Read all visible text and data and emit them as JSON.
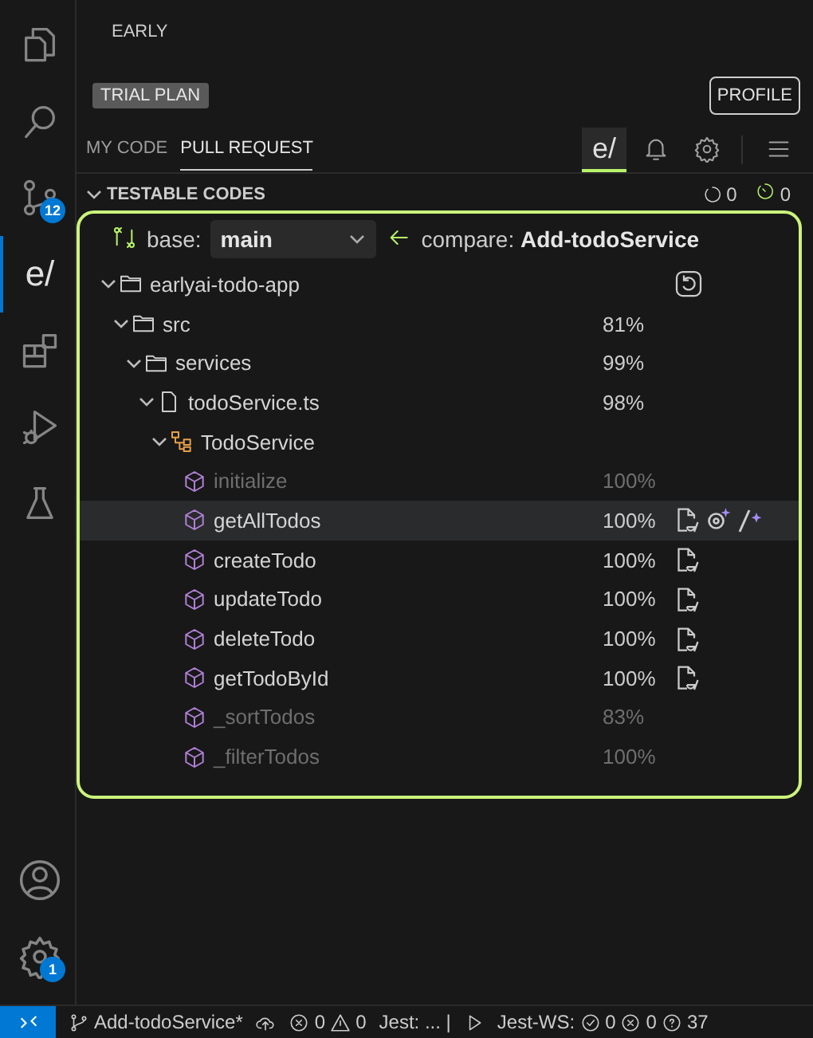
{
  "activity_bar": {
    "items": [
      {
        "kind": "files",
        "selected": false
      },
      {
        "kind": "search",
        "selected": false
      },
      {
        "kind": "source-control",
        "selected": false,
        "badge": "12"
      },
      {
        "kind": "logo",
        "label": "e/",
        "selected": true
      },
      {
        "kind": "extensions",
        "selected": false
      },
      {
        "kind": "run-debug",
        "selected": false
      },
      {
        "kind": "testing",
        "selected": false
      }
    ],
    "bottom": [
      {
        "kind": "account"
      },
      {
        "kind": "settings",
        "badge": "1"
      }
    ]
  },
  "header": {
    "title": "EARLY",
    "plan_badge": "TRIAL PLAN",
    "profile_button": "PROFILE"
  },
  "tabs": [
    {
      "label": "MY CODE",
      "selected": false
    },
    {
      "label": "PULL REQUEST",
      "selected": true
    }
  ],
  "toolbar": [
    {
      "kind": "logo",
      "label": "e/",
      "selected": true
    },
    {
      "kind": "bell",
      "selected": false
    },
    {
      "kind": "gear",
      "selected": false
    },
    {
      "kind": "menu",
      "selected": false
    }
  ],
  "section": {
    "title": "TESTABLE CODES",
    "expanded": true,
    "counters": [
      {
        "kind": "pending",
        "value": "0"
      },
      {
        "kind": "running",
        "value": "0"
      }
    ]
  },
  "compare": {
    "base_label": "base:",
    "base_value": "main",
    "compare_label": "compare:",
    "compare_value": "Add-todoService"
  },
  "tree": [
    {
      "kind": "folder",
      "name": "earlyai-todo-app",
      "expanded": true,
      "selected": false,
      "dimmed": false,
      "actions": [
        {
          "kind": "refresh"
        }
      ],
      "children": [
        {
          "kind": "folder",
          "name": "src",
          "coverage": "81%",
          "expanded": true,
          "selected": false,
          "dimmed": false,
          "children": [
            {
              "kind": "folder",
              "name": "services",
              "coverage": "99%",
              "expanded": true,
              "selected": false,
              "dimmed": false,
              "children": [
                {
                  "kind": "file",
                  "name": "todoService.ts",
                  "coverage": "98%",
                  "expanded": true,
                  "selected": false,
                  "dimmed": false,
                  "children": [
                    {
                      "kind": "class",
                      "name": "TodoService",
                      "expanded": true,
                      "selected": false,
                      "dimmed": false,
                      "children": [
                        {
                          "kind": "method",
                          "name": "initialize",
                          "coverage": "100%",
                          "selected": false,
                          "dimmed": true
                        },
                        {
                          "kind": "method",
                          "name": "getAllTodos",
                          "coverage": "100%",
                          "selected": true,
                          "dimmed": false,
                          "actions": [
                            {
                              "kind": "test-file"
                            },
                            {
                              "kind": "generate"
                            },
                            {
                              "kind": "magic"
                            }
                          ]
                        },
                        {
                          "kind": "method",
                          "name": "createTodo",
                          "coverage": "100%",
                          "selected": false,
                          "dimmed": false,
                          "actions": [
                            {
                              "kind": "test-file"
                            }
                          ]
                        },
                        {
                          "kind": "method",
                          "name": "updateTodo",
                          "coverage": "100%",
                          "selected": false,
                          "dimmed": false,
                          "actions": [
                            {
                              "kind": "test-file"
                            }
                          ]
                        },
                        {
                          "kind": "method",
                          "name": "deleteTodo",
                          "coverage": "100%",
                          "selected": false,
                          "dimmed": false,
                          "actions": [
                            {
                              "kind": "test-file"
                            }
                          ]
                        },
                        {
                          "kind": "method",
                          "name": "getTodoById",
                          "coverage": "100%",
                          "selected": false,
                          "dimmed": false,
                          "actions": [
                            {
                              "kind": "test-file"
                            }
                          ]
                        },
                        {
                          "kind": "method",
                          "name": "_sortTodos",
                          "coverage": "83%",
                          "selected": false,
                          "dimmed": true
                        },
                        {
                          "kind": "method",
                          "name": "_filterTodos",
                          "coverage": "100%",
                          "selected": false,
                          "dimmed": true
                        }
                      ]
                    }
                  ]
                }
              ]
            }
          ]
        }
      ]
    }
  ],
  "status_bar": {
    "branch": "Add-todoService*",
    "errors": "0",
    "warnings": "0",
    "jest": "Jest: ... |",
    "jest_ws": "Jest-WS:",
    "passed": "0",
    "failed": "0",
    "unknown": "37"
  }
}
